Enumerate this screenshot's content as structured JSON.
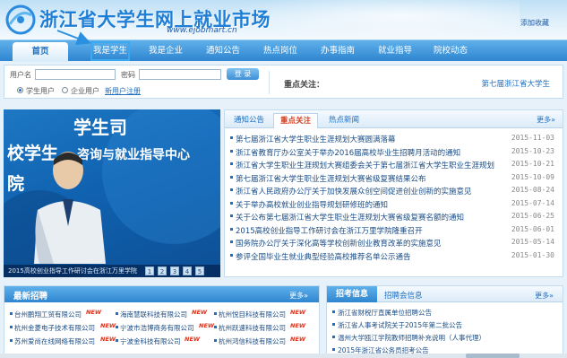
{
  "header": {
    "site_title": "浙江省大学生网上就业市场",
    "domain": "www.ejobmart.cn",
    "favorite": "添加收藏"
  },
  "nav": {
    "items": [
      "首页",
      "我是学生",
      "我是企业",
      "通知公告",
      "热点岗位",
      "办事指南",
      "就业指导",
      "院校动态"
    ]
  },
  "login": {
    "username_label": "用户名",
    "password_label": "密码",
    "login_button": "登 录",
    "radio_student": "学生用户",
    "radio_company": "企业用户",
    "register": "新用户注册",
    "selected_radio": "学生用户",
    "focus_title": "重点关注：",
    "focus_text": "第七届浙江省大学生"
  },
  "banner": {
    "line1": "学生司",
    "line2": "校学生",
    "line3": "咨询与就业指导中心",
    "line4": "院",
    "caption": "2015高校创业指导工作研讨会在浙江万里学院",
    "pages": [
      "1",
      "2",
      "3",
      "4",
      "5"
    ]
  },
  "news": {
    "tabs": [
      "通知公告",
      "重点关注",
      "热点新闻"
    ],
    "active_tab": "重点关注",
    "more": "更多»",
    "items": [
      {
        "title": "第七届浙江省大学生职业生涯规划大赛圆满落幕",
        "date": "2015-11-03"
      },
      {
        "title": "浙江省教育厅办公室关于举办2016届高校毕业生招聘月活动的通知",
        "date": "2015-10-23"
      },
      {
        "title": "浙江省大学生职业生涯规划大赛组委会关于第七届浙江省大学生职业生涯规划",
        "date": "2015-10-21"
      },
      {
        "title": "第七届浙江省大学生职业生涯规划大赛省级复赛结果公布",
        "date": "2015-10-09"
      },
      {
        "title": "浙江省人民政府办公厅关于加快发展众创空间促进创业创新的实施意见",
        "date": "2015-08-24"
      },
      {
        "title": "关于举办高校就业创业指导规划研修班的通知",
        "date": "2015-07-14"
      },
      {
        "title": "关于公布第七届浙江省大学生职业生涯规划大赛省级复赛名额的通知",
        "date": "2015-06-25"
      },
      {
        "title": "2015高校创业指导工作研讨会在浙江万里学院隆重召开",
        "date": "2015-06-01"
      },
      {
        "title": "国务院办公厅关于深化高等学校创新创业教育改革的实施意见",
        "date": "2015-05-14"
      },
      {
        "title": "参评全国毕业生就业典型经验高校推荐名单公示通告",
        "date": "2015-01-30"
      }
    ]
  },
  "recruit": {
    "title": "最新招聘",
    "more": "更多»",
    "new_badge": "NEW",
    "columns": [
      [
        "台州鹏翔工贸有限公司",
        "杭州金菱电子技术有限公司",
        "苏州爱尚在线网络有限公司"
      ],
      [
        "海南慧联科技有限公司",
        "宁波市浩博商务有限公司",
        "宁波金科技有限公司"
      ],
      [
        "杭州悦目科技有限公司",
        "杭州跃速科技有限公司",
        "杭州鸿信科技有限公司"
      ]
    ]
  },
  "info": {
    "tab1": "招考信息",
    "tab2": "招聘会信息",
    "more": "更多»",
    "items": [
      "浙江省财税厅直属单位招聘公告",
      "浙江省人事考试院关于2015年第二批公告",
      "温州大学瓯江学院教师招聘补充说明（人事代理）",
      "2015年浙江省公务员招考公告"
    ]
  }
}
